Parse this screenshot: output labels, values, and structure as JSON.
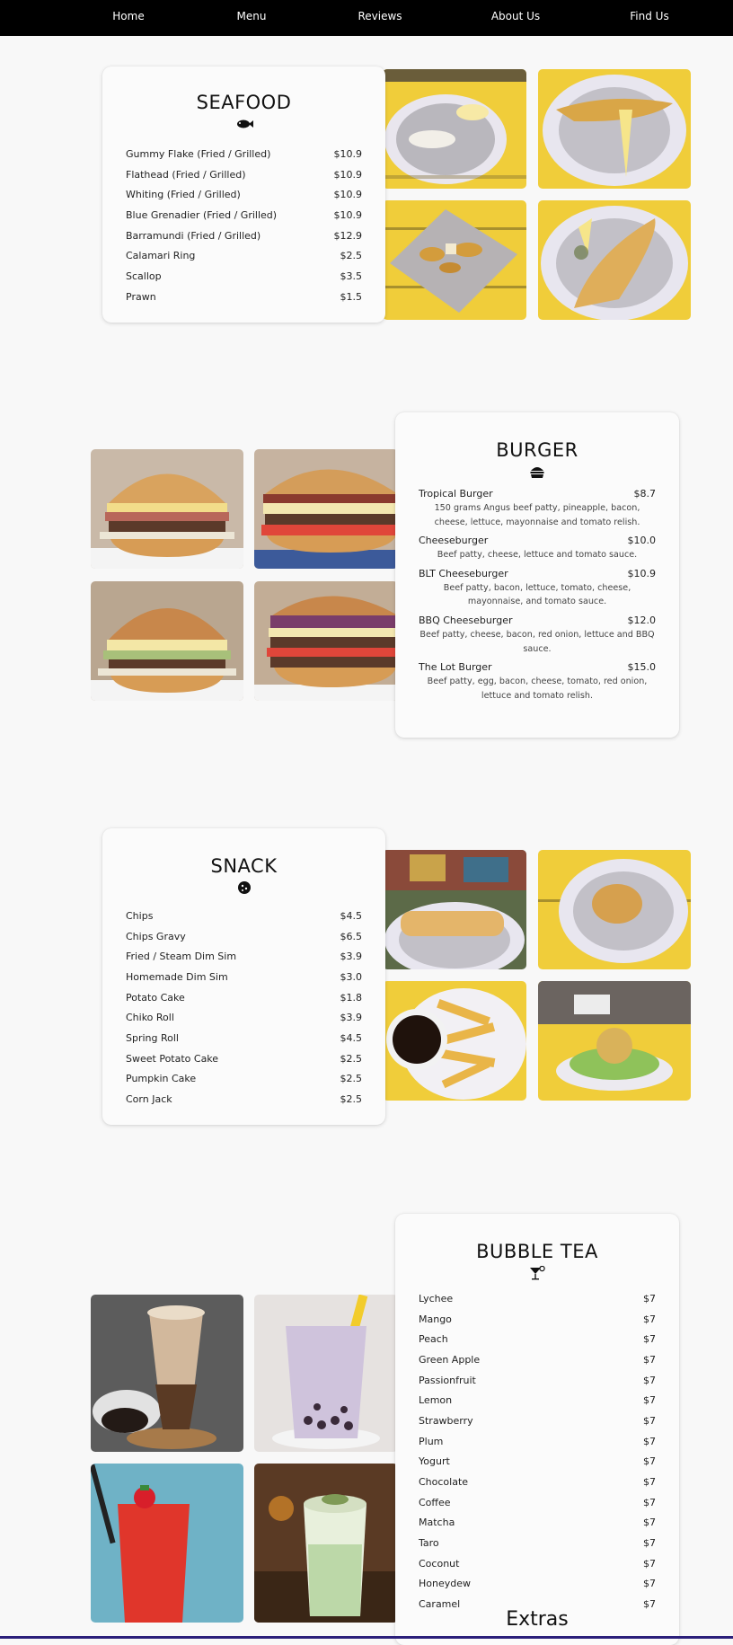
{
  "nav": {
    "items": [
      {
        "label": "Home"
      },
      {
        "label": "Menu"
      },
      {
        "label": "Reviews"
      },
      {
        "label": "About Us"
      },
      {
        "label": "Find Us"
      }
    ]
  },
  "seafood": {
    "title": "SEAFOOD",
    "icon": "fish-icon",
    "items": [
      {
        "name": "Gummy Flake (Fried / Grilled)",
        "price": "$10.9"
      },
      {
        "name": "Flathead (Fried / Grilled)",
        "price": "$10.9"
      },
      {
        "name": "Whiting (Fried / Grilled)",
        "price": "$10.9"
      },
      {
        "name": "Blue Grenadier (Fried / Grilled)",
        "price": "$10.9"
      },
      {
        "name": "Barramundi (Fried / Grilled)",
        "price": "$12.9"
      },
      {
        "name": "Calamari Ring",
        "price": "$2.5"
      },
      {
        "name": "Scallop",
        "price": "$3.5"
      },
      {
        "name": "Prawn",
        "price": "$1.5"
      }
    ]
  },
  "burger": {
    "title": "BURGER",
    "icon": "burger-icon",
    "items": [
      {
        "name": "Tropical Burger",
        "price": "$8.7",
        "desc": "150 grams Angus beef patty, pineapple, bacon, cheese, lettuce, mayonnaise and tomato relish."
      },
      {
        "name": "Cheeseburger",
        "price": "$10.0",
        "desc": "Beef patty, cheese, lettuce and tomato sauce."
      },
      {
        "name": "BLT Cheeseburger",
        "price": "$10.9",
        "desc": "Beef patty, bacon, lettuce, tomato, cheese, mayonnaise, and tomato sauce."
      },
      {
        "name": "BBQ Cheeseburger",
        "price": "$12.0",
        "desc": "Beef patty, cheese, bacon, red onion, lettuce and BBQ sauce."
      },
      {
        "name": "The Lot Burger",
        "price": "$15.0",
        "desc": "Beef patty, egg, bacon, cheese, tomato, red onion, lettuce and tomato relish."
      }
    ]
  },
  "snack": {
    "title": "SNACK",
    "icon": "cookie-icon",
    "items": [
      {
        "name": "Chips",
        "price": "$4.5"
      },
      {
        "name": "Chips Gravy",
        "price": "$6.5"
      },
      {
        "name": "Fried / Steam Dim Sim",
        "price": "$3.9"
      },
      {
        "name": "Homemade Dim Sim",
        "price": "$3.0"
      },
      {
        "name": "Potato Cake",
        "price": "$1.8"
      },
      {
        "name": "Chiko Roll",
        "price": "$3.9"
      },
      {
        "name": "Spring Roll",
        "price": "$4.5"
      },
      {
        "name": "Sweet Potato Cake",
        "price": "$2.5"
      },
      {
        "name": "Pumpkin Cake",
        "price": "$2.5"
      },
      {
        "name": "Corn Jack",
        "price": "$2.5"
      }
    ]
  },
  "bubble_tea": {
    "title": "BUBBLE TEA",
    "icon": "cocktail-icon",
    "items": [
      {
        "name": "Lychee",
        "price": "$7"
      },
      {
        "name": "Mango",
        "price": "$7"
      },
      {
        "name": "Peach",
        "price": "$7"
      },
      {
        "name": "Green Apple",
        "price": "$7"
      },
      {
        "name": "Passionfruit",
        "price": "$7"
      },
      {
        "name": "Lemon",
        "price": "$7"
      },
      {
        "name": "Strawberry",
        "price": "$7"
      },
      {
        "name": "Plum",
        "price": "$7"
      },
      {
        "name": "Yogurt",
        "price": "$7"
      },
      {
        "name": "Chocolate",
        "price": "$7"
      },
      {
        "name": "Coffee",
        "price": "$7"
      },
      {
        "name": "Matcha",
        "price": "$7"
      },
      {
        "name": "Taro",
        "price": "$7"
      },
      {
        "name": "Coconut",
        "price": "$7"
      },
      {
        "name": "Honeydew",
        "price": "$7"
      },
      {
        "name": "Caramel",
        "price": "$7"
      }
    ],
    "extras_heading": "Extras"
  },
  "colors": {
    "nav_bg": "#000000",
    "page_bg": "#f8f8f8",
    "card_bg": "#fbfbfb",
    "photo_yellow": "#f1cf3c"
  }
}
